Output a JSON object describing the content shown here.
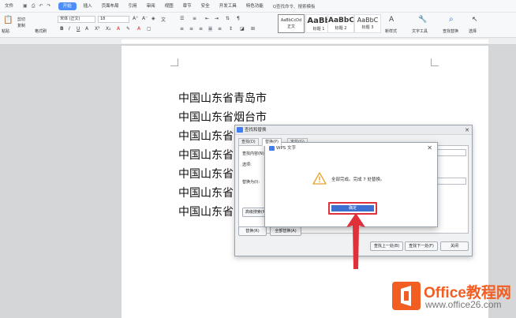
{
  "menubar": {
    "file": "文件",
    "tabs": [
      "开始",
      "插入",
      "页面布局",
      "引用",
      "审阅",
      "视图",
      "章节",
      "安全",
      "开发工具",
      "特色功能"
    ],
    "active_tab": "开始",
    "search": "Q查找命令、搜索模板"
  },
  "ribbon": {
    "cut": "剪切",
    "copy": "复制",
    "paste": "粘贴",
    "format_painter": "格式刷",
    "font_name": "宋体 (正文)",
    "font_size": "18",
    "styles": [
      {
        "preview": "AaBbCcDd",
        "label": "正文"
      },
      {
        "preview": "AaBb",
        "label": "标题 1"
      },
      {
        "preview": "AaBbC",
        "label": "标题 2"
      },
      {
        "preview": "AaBbC",
        "label": "标题 3"
      }
    ],
    "new_style": "新样式",
    "text_tools": "文字工具",
    "find_replace": "查找替换",
    "select": "选择"
  },
  "document": {
    "lines": [
      "中国山东省青岛市",
      "中国山东省烟台市",
      "中国山东省",
      "中国山东省",
      "中国山东省",
      "中国山东省",
      "中国山东省"
    ]
  },
  "find_dialog": {
    "title": "查找和替换",
    "tabs": [
      "查找(D)",
      "替换(P)",
      "定位(G)"
    ],
    "find_label": "查找内容(N):",
    "options_label": "选项:",
    "replace_label": "替换为(I):",
    "advanced": "高级搜索(M)",
    "replace_btn": "替换(R)",
    "replace_all_btn": "全部替换(A)",
    "find_prev": "查找上一处(B)",
    "find_next": "查找下一处(F)",
    "close": "关闭"
  },
  "alert": {
    "title": "WPS 文字",
    "message": "全部完成。完成 7 处替换。",
    "ok": "确定"
  },
  "watermark": {
    "brand": "Office教程网",
    "url": "www.office26.com"
  },
  "colors": {
    "accent": "#3d6fd1",
    "highlight": "#e0313a",
    "brand": "#f25d22"
  }
}
